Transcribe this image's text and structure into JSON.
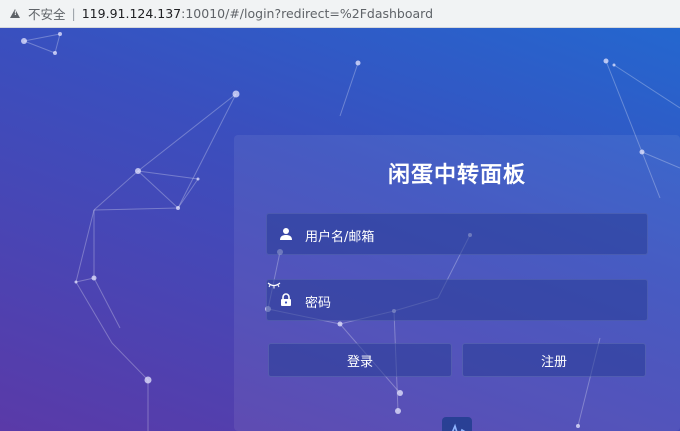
{
  "browser": {
    "security_text": "不安全",
    "separator": "|",
    "url_host": "119.91.124.137",
    "url_path": ":10010/#/login?redirect=%2Fdashboard"
  },
  "login": {
    "title": "闲蛋中转面板",
    "username_placeholder": "用户名/邮箱",
    "password_placeholder": "密码",
    "login_button": "登录",
    "register_button": "注册"
  },
  "colors": {
    "bg_top": "#2467cf",
    "bg_bottom": "#5a3aa8"
  },
  "icons": [
    "warning-icon",
    "user-icon",
    "lock-icon",
    "eye-closed-icon",
    "activity-logo-icon"
  ]
}
